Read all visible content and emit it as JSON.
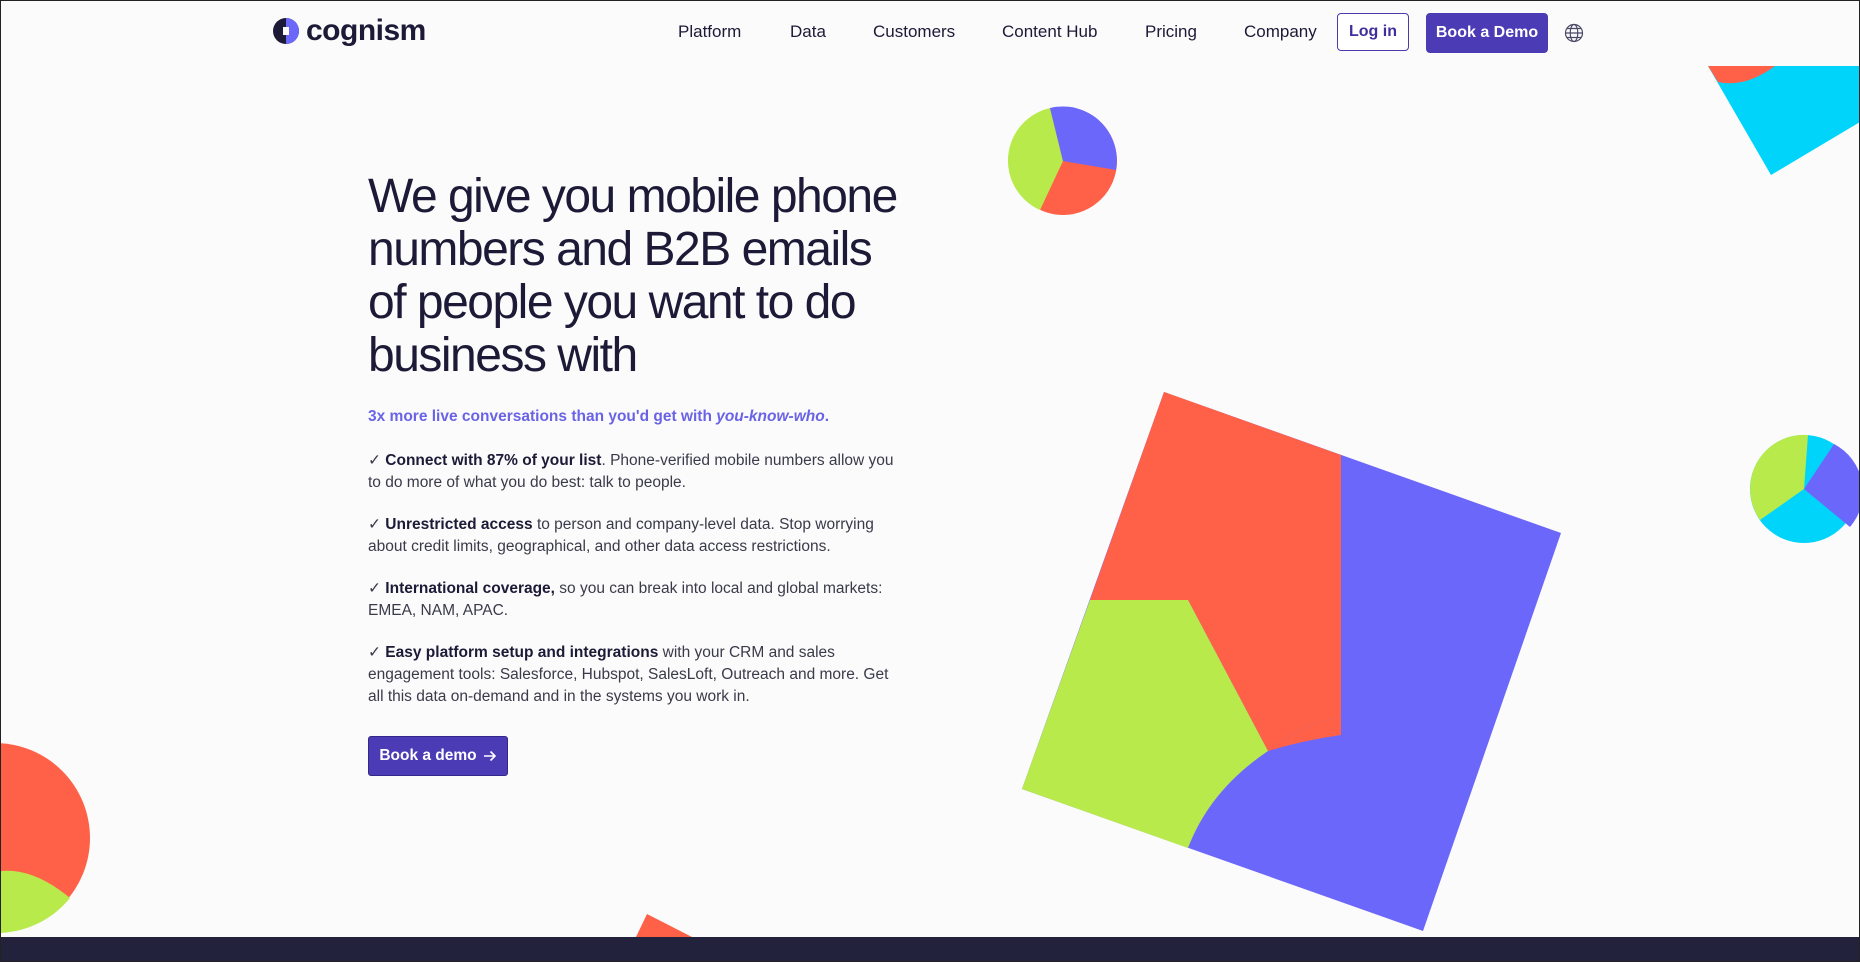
{
  "brand": {
    "name": "cognism",
    "colors": {
      "primary": "#4b3cb6",
      "accent_text": "#6a63e6",
      "red": "#ff6148",
      "lime": "#b8ea4b",
      "blue": "#6b67fb",
      "cyan": "#00d4fb",
      "dark": "#23223d"
    }
  },
  "nav": {
    "links": [
      "Platform",
      "Data",
      "Customers",
      "Content Hub",
      "Pricing",
      "Company"
    ],
    "login_label": "Log in",
    "book_demo_label": "Book a Demo",
    "language_icon": "globe-icon"
  },
  "hero": {
    "headline": "We give you mobile phone numbers and B2B emails of people you want to do business with",
    "tagline_prefix": "3x more live conversations than you'd get with ",
    "tagline_emphasis": "you-know-who",
    "tagline_suffix": ".",
    "features": [
      {
        "check": "✓ ",
        "title": "Connect with 87% of your list",
        "text": ". Phone-verified mobile numbers allow you to do more of what you do best: talk to people."
      },
      {
        "check": "✓ ",
        "title": "Unrestricted access",
        "text": " to person and company-level data. Stop worrying about credit limits, geographical, and other data access restrictions."
      },
      {
        "check": "✓ ",
        "title": "International coverage,",
        "text": " so you can break into local and global markets: EMEA, NAM, APAC."
      },
      {
        "check": "✓ ",
        "title": "Easy platform setup and integrations",
        "text": " with your CRM and sales engagement tools: Salesforce, Hubspot, SalesLoft, Outreach and more. Get all this data on-demand and in the systems you work in."
      }
    ],
    "cta_label": "Book a demo",
    "cta_icon": "arrow-right-icon"
  }
}
